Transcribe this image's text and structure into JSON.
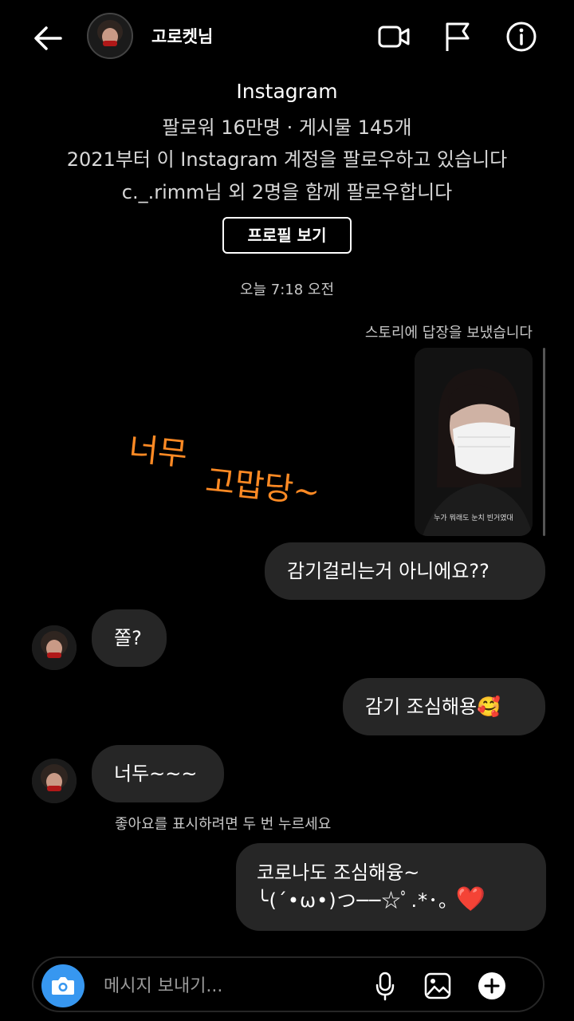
{
  "header": {
    "username": "고로켓님",
    "icons": [
      "back-arrow-icon",
      "video-call-icon",
      "flag-icon",
      "info-icon"
    ]
  },
  "profile": {
    "name": "Instagram",
    "stats": "팔로워 16만명 · 게시물 145개",
    "since": "2021부터 이 Instagram 계정을 팔로우하고 있습니다",
    "mutual": "c._.rimm님 외 2명을 함께 팔로우합니다",
    "view_profile_label": "프로필 보기"
  },
  "chat": {
    "timestamp": "오늘 7:18 오전",
    "story_reply_label": "스토리에 답장을 보냈습니다",
    "story_caption": "누가 뭐래도 눈치 빈거였대",
    "overlay_text_1": "너무",
    "overlay_text_2": "고맙당~",
    "messages": [
      {
        "side": "right",
        "text": "감기걸리는거 아니에요??"
      },
      {
        "side": "left",
        "text": "쫄?"
      },
      {
        "side": "right",
        "text": "감기 조심해용🥰"
      },
      {
        "side": "left",
        "text": "너두~~~"
      },
      {
        "side": "right",
        "line1": "코로나도 조심해융~",
        "line2": "╰(´•ω•)つ──☆ﾟ.*･｡",
        "heart": "❤️"
      }
    ],
    "like_hint": "좋아요를 표시하려면 두 번 누르세요"
  },
  "composer": {
    "placeholder": "메시지 보내기...",
    "icons": [
      "camera-icon",
      "mic-icon",
      "gallery-icon",
      "plus-icon"
    ]
  },
  "colors": {
    "background": "#000000",
    "bubble": "#262626",
    "accent": "#3797f0",
    "handwriting": "#ff8a24"
  }
}
